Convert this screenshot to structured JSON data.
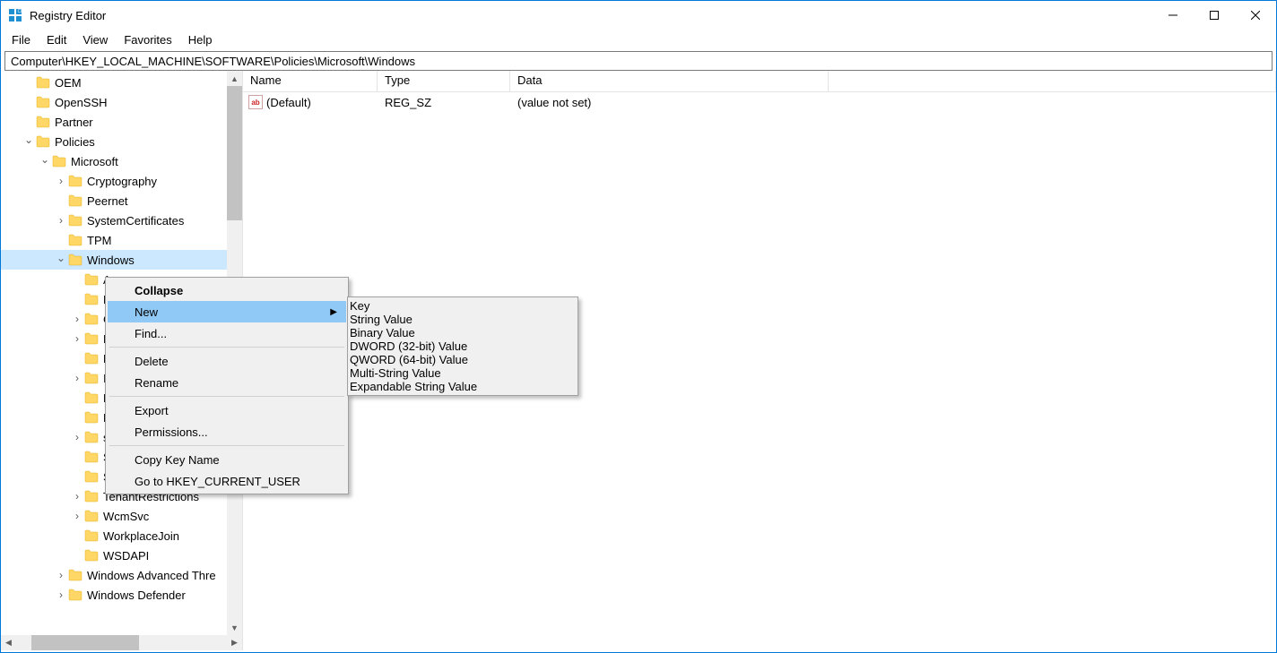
{
  "window": {
    "title": "Registry Editor"
  },
  "menubar": {
    "items": [
      "File",
      "Edit",
      "View",
      "Favorites",
      "Help"
    ]
  },
  "addressbar": {
    "path": "Computer\\HKEY_LOCAL_MACHINE\\SOFTWARE\\Policies\\Microsoft\\Windows"
  },
  "tree": {
    "items": [
      {
        "indent": 2,
        "twisty": "",
        "label": "OEM"
      },
      {
        "indent": 2,
        "twisty": "",
        "label": "OpenSSH"
      },
      {
        "indent": 2,
        "twisty": "",
        "label": "Partner"
      },
      {
        "indent": 2,
        "twisty": "v",
        "label": "Policies"
      },
      {
        "indent": 3,
        "twisty": "v",
        "label": "Microsoft"
      },
      {
        "indent": 4,
        "twisty": ">",
        "label": "Cryptography"
      },
      {
        "indent": 4,
        "twisty": "",
        "label": "Peernet"
      },
      {
        "indent": 4,
        "twisty": ">",
        "label": "SystemCertificates"
      },
      {
        "indent": 4,
        "twisty": "",
        "label": "TPM"
      },
      {
        "indent": 4,
        "twisty": "v",
        "label": "Windows",
        "selected": true
      },
      {
        "indent": 5,
        "twisty": "",
        "label": "A"
      },
      {
        "indent": 5,
        "twisty": "",
        "label": "B"
      },
      {
        "indent": 5,
        "twisty": ">",
        "label": "C"
      },
      {
        "indent": 5,
        "twisty": ">",
        "label": "D"
      },
      {
        "indent": 5,
        "twisty": "",
        "label": "E"
      },
      {
        "indent": 5,
        "twisty": ">",
        "label": "I"
      },
      {
        "indent": 5,
        "twisty": "",
        "label": "N"
      },
      {
        "indent": 5,
        "twisty": "",
        "label": "N"
      },
      {
        "indent": 5,
        "twisty": ">",
        "label": "s"
      },
      {
        "indent": 5,
        "twisty": "",
        "label": "S"
      },
      {
        "indent": 5,
        "twisty": "",
        "label": "System"
      },
      {
        "indent": 5,
        "twisty": ">",
        "label": "TenantRestrictions"
      },
      {
        "indent": 5,
        "twisty": ">",
        "label": "WcmSvc"
      },
      {
        "indent": 5,
        "twisty": "",
        "label": "WorkplaceJoin"
      },
      {
        "indent": 5,
        "twisty": "",
        "label": "WSDAPI"
      },
      {
        "indent": 4,
        "twisty": ">",
        "label": "Windows Advanced Thre"
      },
      {
        "indent": 4,
        "twisty": ">",
        "label": "Windows Defender"
      }
    ]
  },
  "list": {
    "columns": {
      "name": "Name",
      "type": "Type",
      "data": "Data"
    },
    "rows": [
      {
        "name": "(Default)",
        "type": "REG_SZ",
        "data": "(value not set)",
        "icon": "ab"
      }
    ]
  },
  "context_menu": {
    "items": [
      {
        "label": "Collapse",
        "bold": true
      },
      {
        "label": "New",
        "highlight": true,
        "submenu": true
      },
      {
        "label": "Find..."
      },
      {
        "sep": true
      },
      {
        "label": "Delete"
      },
      {
        "label": "Rename"
      },
      {
        "sep": true
      },
      {
        "label": "Export"
      },
      {
        "label": "Permissions..."
      },
      {
        "sep": true
      },
      {
        "label": "Copy Key Name"
      },
      {
        "label": "Go to HKEY_CURRENT_USER"
      }
    ]
  },
  "submenu": {
    "items": [
      {
        "label": "Key",
        "highlight": true
      },
      {
        "sep": true
      },
      {
        "label": "String Value"
      },
      {
        "label": "Binary Value"
      },
      {
        "label": "DWORD (32-bit) Value"
      },
      {
        "label": "QWORD (64-bit) Value"
      },
      {
        "label": "Multi-String Value"
      },
      {
        "label": "Expandable String Value"
      }
    ]
  }
}
